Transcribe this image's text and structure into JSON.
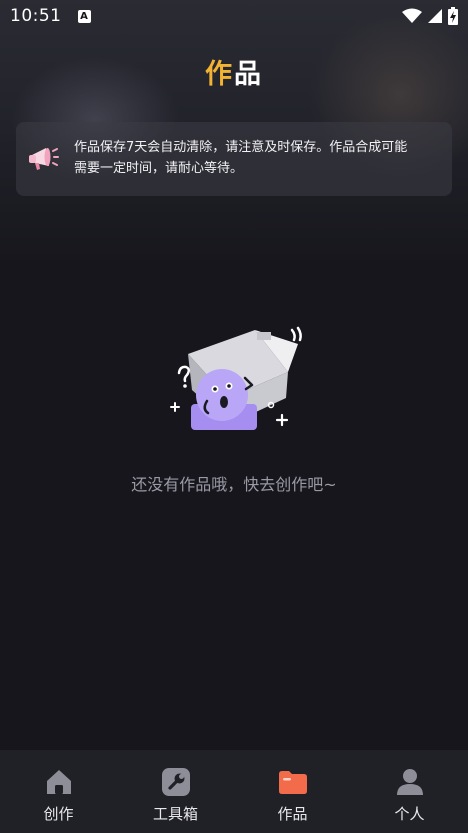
{
  "status_bar": {
    "time": "10:51",
    "notification_icon": "a-icon",
    "wifi_icon": "wifi-icon",
    "signal_icon": "signal-icon",
    "battery_icon": "battery-charging-icon"
  },
  "header": {
    "title": "作品"
  },
  "notice": {
    "icon": "megaphone-icon",
    "text_line1": "作品保存7天会自动清除，请注意及时保存。作品合成可能",
    "text_line2": "需要一定时间，请耐心等待。"
  },
  "empty_state": {
    "illustration": "empty-box-illustration",
    "message": "还没有作品哦，快去创作吧~"
  },
  "tab_bar": {
    "tabs": [
      {
        "label": "创作",
        "icon": "home-icon",
        "active": false
      },
      {
        "label": "工具箱",
        "icon": "wrench-icon",
        "active": false
      },
      {
        "label": "作品",
        "icon": "folder-icon",
        "active": true
      },
      {
        "label": "个人",
        "icon": "person-icon",
        "active": false
      }
    ]
  },
  "colors": {
    "background": "#16161c",
    "tab_bar_bg": "#202027",
    "active_tab_accent": "#f26b4b",
    "title_accent": "#f2b233",
    "illustration_purple": "#a58ef0"
  }
}
